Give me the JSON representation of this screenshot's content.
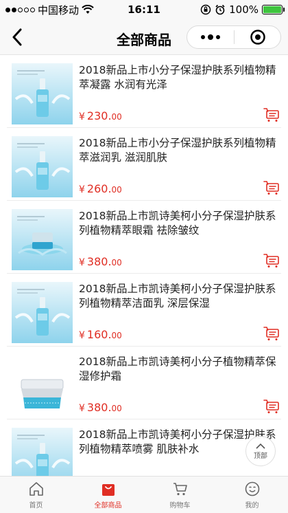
{
  "status_bar": {
    "carrier": "中国移动",
    "time": "16:11",
    "battery": "100%",
    "battery_level": 1.0
  },
  "nav": {
    "title": "全部商品"
  },
  "products": [
    {
      "title": "2018新品上市小分子保湿护肤系列植物精萃凝露 水润有光泽",
      "price_yen": "¥",
      "price_int": "230.",
      "price_cents": "00"
    },
    {
      "title": "2018新品上市小分子保湿护肤系列植物精萃滋润乳 滋润肌肤",
      "price_yen": "¥",
      "price_int": "260.",
      "price_cents": "00"
    },
    {
      "title": "2018新品上市凯诗美柯小分子保湿护肤系列植物精萃眼霜 祛除皱纹",
      "price_yen": "¥",
      "price_int": "380.",
      "price_cents": "00"
    },
    {
      "title": "2018新品上市凯诗美柯小分子保湿护肤系列植物精萃洁面乳 深层保湿",
      "price_yen": "¥",
      "price_int": "160.",
      "price_cents": "00"
    },
    {
      "title": "2018新品上市凯诗美柯小分子植物精萃保湿修护霜",
      "price_yen": "¥",
      "price_int": "380.",
      "price_cents": "00"
    },
    {
      "title": "2018新品上市凯诗美柯小分子保湿护肤系列植物精萃喷雾 肌肤补水",
      "price_yen": "¥",
      "price_int": "",
      "price_cents": ""
    }
  ],
  "to_top": {
    "label": "顶部"
  },
  "tabs": [
    {
      "label": "首页",
      "icon": "home-icon",
      "active": false
    },
    {
      "label": "全部商品",
      "icon": "bag-icon",
      "active": true
    },
    {
      "label": "购物车",
      "icon": "cart-icon",
      "active": false
    },
    {
      "label": "我的",
      "icon": "user-icon",
      "active": false
    }
  ],
  "colors": {
    "accent": "#e02e24",
    "product_image_blue": "#5bbfe0"
  }
}
